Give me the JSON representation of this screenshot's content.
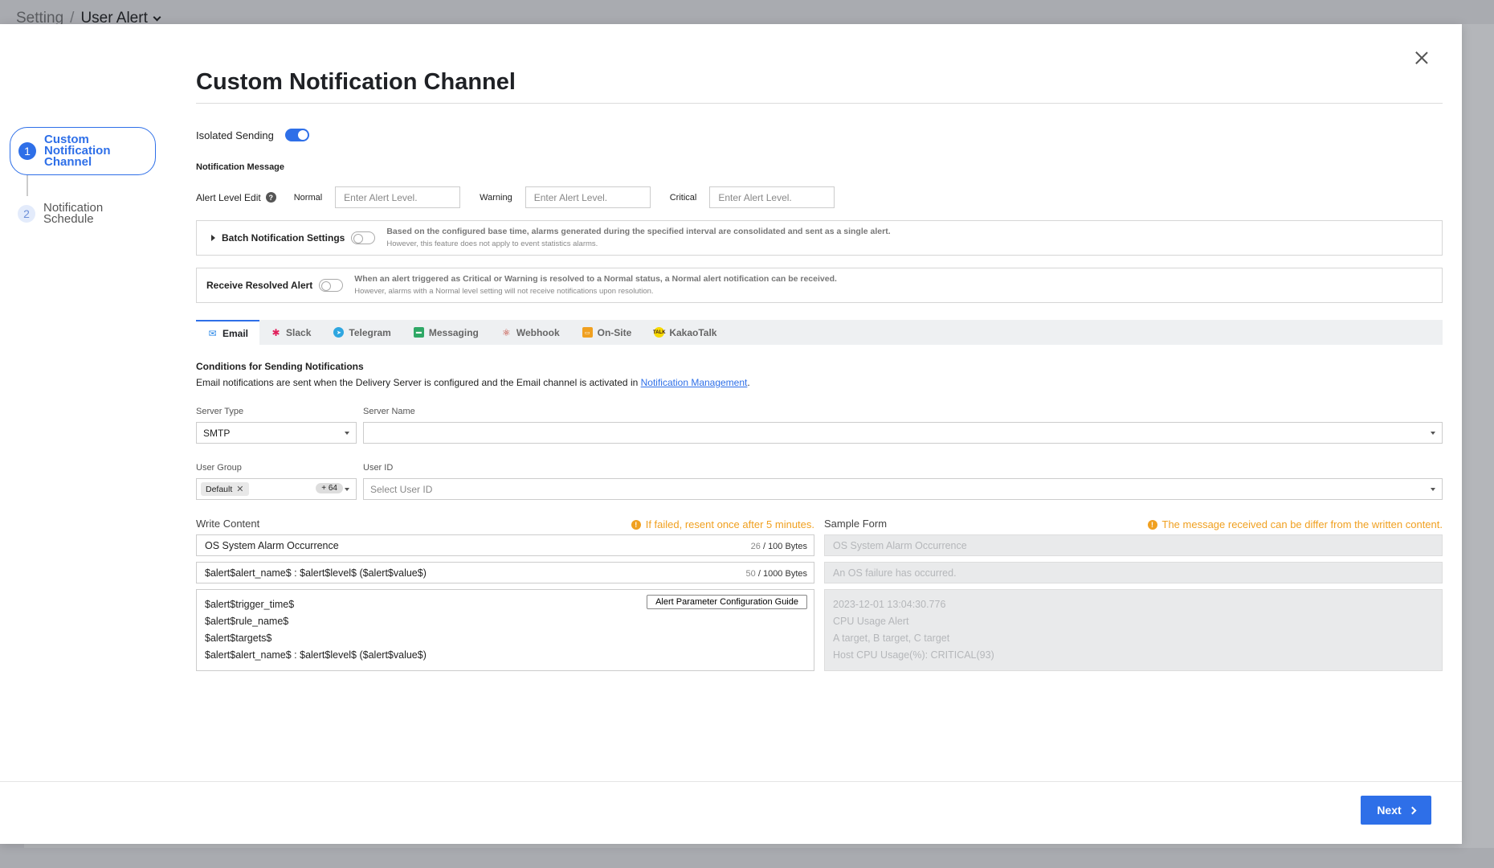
{
  "background": {
    "breadcrumb": {
      "root": "Setting",
      "separator": "/",
      "current": "User Alert"
    }
  },
  "modal": {
    "title": "Custom Notification Channel",
    "steps": [
      {
        "num": "1",
        "label": "Custom Notification Channel",
        "active": true
      },
      {
        "num": "2",
        "label": "Notification Schedule",
        "active": false
      }
    ],
    "isolated_sending": {
      "label": "Isolated Sending",
      "on": true
    },
    "notification_message_label": "Notification Message",
    "alert_level": {
      "label": "Alert Level Edit",
      "help": "?",
      "normal_label": "Normal",
      "warning_label": "Warning",
      "critical_label": "Critical",
      "placeholder": "Enter Alert Level."
    },
    "batch": {
      "title": "Batch Notification Settings",
      "on": false,
      "desc1": "Based on the configured base time, alarms generated during the specified interval are consolidated and sent as a single alert.",
      "desc2": "However, this feature does not apply to event statistics alarms."
    },
    "resolved": {
      "title": "Receive Resolved Alert",
      "on": false,
      "desc1": "When an alert triggered as Critical or Warning is resolved to a Normal status, a Normal alert notification can be received.",
      "desc2": "However, alarms with a Normal level setting will not receive notifications upon resolution."
    },
    "tabs": [
      {
        "label": "Email",
        "icon": "email-icon",
        "active": true,
        "color": "#2e8ae8"
      },
      {
        "label": "Slack",
        "icon": "slack-icon",
        "active": false,
        "color": "#e01e5a"
      },
      {
        "label": "Telegram",
        "icon": "telegram-icon",
        "active": false,
        "color": "#2ea6e0"
      },
      {
        "label": "Messaging",
        "icon": "messaging-icon",
        "active": false,
        "color": "#2fa866"
      },
      {
        "label": "Webhook",
        "icon": "webhook-icon",
        "active": false,
        "color": "#c0392b"
      },
      {
        "label": "On-Site",
        "icon": "on-site-icon",
        "active": false,
        "color": "#f0a020"
      },
      {
        "label": "KakaoTalk",
        "icon": "kakaotalk-icon",
        "active": false,
        "color": "#f7d900"
      }
    ],
    "conditions": {
      "title": "Conditions for Sending Notifications",
      "desc_prefix": "Email notifications are sent when the Delivery Server is configured and the Email channel is activated in ",
      "link": "Notification Management",
      "desc_suffix": "."
    },
    "server_type": {
      "label": "Server Type",
      "value": "SMTP"
    },
    "server_name": {
      "label": "Server Name",
      "value": ""
    },
    "user_group": {
      "label": "User Group",
      "chip": "Default",
      "more": "+ 64"
    },
    "user_id": {
      "label": "User ID",
      "placeholder": "Select User ID"
    },
    "write_content": {
      "label": "Write Content",
      "warning": "If failed, resent once after 5 minutes.",
      "subject": "OS System Alarm Occurrence",
      "subject_count": "26",
      "subject_limit": "/ 100 Bytes",
      "summary": "$alert$alert_name$ : $alert$level$ ($alert$value$)",
      "summary_count": "50",
      "summary_limit": "/ 1000 Bytes",
      "body_lines": [
        "$alert$trigger_time$",
        "$alert$rule_name$",
        "$alert$targets$",
        "$alert$alert_name$ : $alert$level$ ($alert$value$)"
      ],
      "guide_button": "Alert Parameter Configuration Guide"
    },
    "sample_form": {
      "label": "Sample Form",
      "warning": "The message received can be differ from the written content.",
      "subject": "OS System Alarm Occurrence",
      "summary": "An OS failure has occurred.",
      "body_lines": [
        "2023-12-01 13:04:30.776",
        "CPU Usage Alert",
        "A target, B target, C target",
        "Host CPU Usage(%): CRITICAL(93)"
      ]
    },
    "next_button": "Next"
  }
}
